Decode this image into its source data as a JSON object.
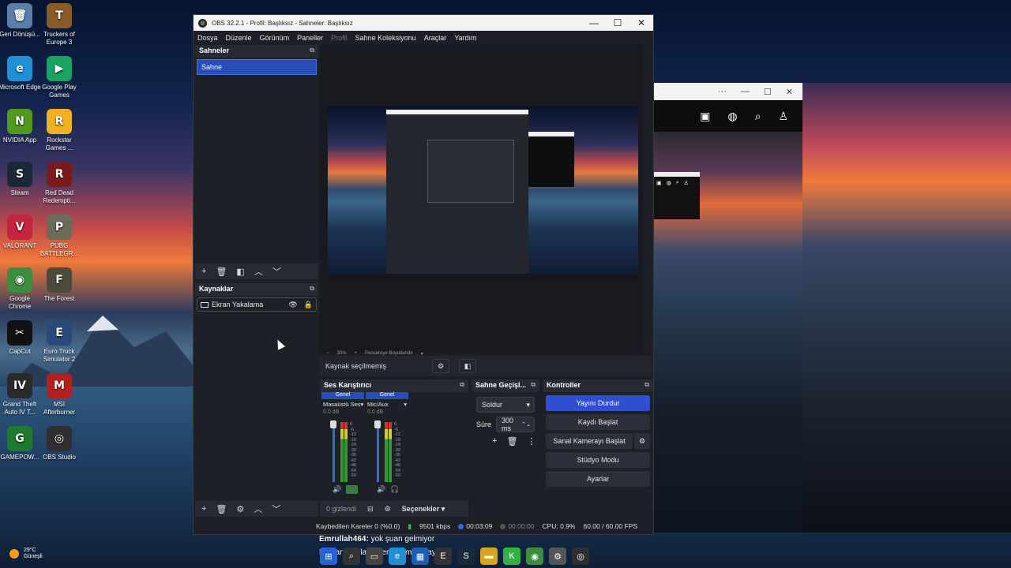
{
  "desktop": {
    "icons": [
      {
        "label": "Geri Dönüşü...",
        "glyph": "🗑",
        "color": "#5a7fa8"
      },
      {
        "label": "Truckers of Europe 3",
        "glyph": "T",
        "color": "#8a5b2a"
      },
      {
        "label": "Microsoft Edge",
        "glyph": "e",
        "color": "#1f8fd6"
      },
      {
        "label": "Google Play Games",
        "glyph": "▶",
        "color": "#1aa260"
      },
      {
        "label": "NVIDIA App",
        "glyph": "N",
        "color": "#4f9a1c"
      },
      {
        "label": "Rockstar Games ...",
        "glyph": "R",
        "color": "#f0b020"
      },
      {
        "label": "Steam",
        "glyph": "S",
        "color": "#1b2838"
      },
      {
        "label": "Red Dead Redempti...",
        "glyph": "R",
        "color": "#7a1b1b"
      },
      {
        "label": "VALORANT",
        "glyph": "V",
        "color": "#c3253f"
      },
      {
        "label": "PUBG BATTLEGR...",
        "glyph": "P",
        "color": "#6b6b5a"
      },
      {
        "label": "Google Chrome",
        "glyph": "◉",
        "color": "#3c8d3f"
      },
      {
        "label": "The Forest",
        "glyph": "F",
        "color": "#4b4b3a"
      },
      {
        "label": "CapCut",
        "glyph": "✂",
        "color": "#111111"
      },
      {
        "label": "Euro Truck Simulator 2",
        "glyph": "E",
        "color": "#2b4a7a"
      },
      {
        "label": "Grand Theft Auto IV T...",
        "glyph": "IV",
        "color": "#2a2a2a"
      },
      {
        "label": "MSI Afterburner",
        "glyph": "M",
        "color": "#b32020"
      },
      {
        "label": "GAMEPOW...",
        "glyph": "G",
        "color": "#1e7a2e"
      },
      {
        "label": "OBS Studio",
        "glyph": "◎",
        "color": "#302e31"
      }
    ]
  },
  "obs": {
    "window_title": "OBS 32.2.1 - Profil: Başlıksız - Sahneler: Başlıksız",
    "menu": [
      "Dosya",
      "Düzenle",
      "Görünüm",
      "Paneller",
      "Profil",
      "Sahne Koleksiyonu",
      "Araçlar",
      "Yardım"
    ],
    "scenes": {
      "header": "Sahneler",
      "items": [
        "Sahne"
      ]
    },
    "sources": {
      "header": "Kaynaklar",
      "items": [
        "Ekran Yakalama"
      ]
    },
    "preview": {
      "zoom": "30%",
      "fit_label": "Pencereye Boyutlandır"
    },
    "source_bar": {
      "label": "Kaynak seçilmemiş"
    },
    "mixer": {
      "header": "Ses Karıştırıcı",
      "channels": [
        {
          "tag": "Genel",
          "name": "Masaüstü Ses",
          "db": "0.0 dB"
        },
        {
          "tag": "Genel",
          "name": "Mic/Aux",
          "db": "0.0 dB"
        }
      ],
      "scale": [
        "0",
        "-6",
        "-12",
        "-18",
        "-24",
        "-30",
        "-36",
        "-42",
        "-48",
        "-54",
        "-60"
      ],
      "hidden": "0 gizlendi",
      "options": "Seçenekler"
    },
    "transitions": {
      "header": "Sahne Geçişl...",
      "selected": "Soldur",
      "duration_label": "Süre",
      "duration": "300 ms"
    },
    "controls": {
      "header": "Kontroller",
      "buttons": [
        "Yayını Durdur",
        "Kaydı Başlat",
        "Sanal Kamerayı Başlat",
        "Stüdyo Modu",
        "Ayarlar"
      ]
    },
    "status": {
      "dropped": "Kaybedilen Kareler 0 (%0.0)",
      "bitrate": "9501 kbps",
      "stream_time": "00:03:09",
      "rec_time": "00:00:00",
      "cpu": "CPU: 0.9%",
      "fps": "60.00 / 60.00 FPS"
    }
  },
  "chat": {
    "line1_user": "Emrullah464:",
    "line1_msg": "yok şuan gelmiyor",
    "line2": "Berkan Sağlam: ben gittim iyi yayınlar"
  },
  "weather": {
    "temp": "29°C",
    "cond": "Güneşli"
  },
  "colors": {
    "accent": "#2f4fd0",
    "panel": "#272a33",
    "bg": "#1d1f26"
  }
}
